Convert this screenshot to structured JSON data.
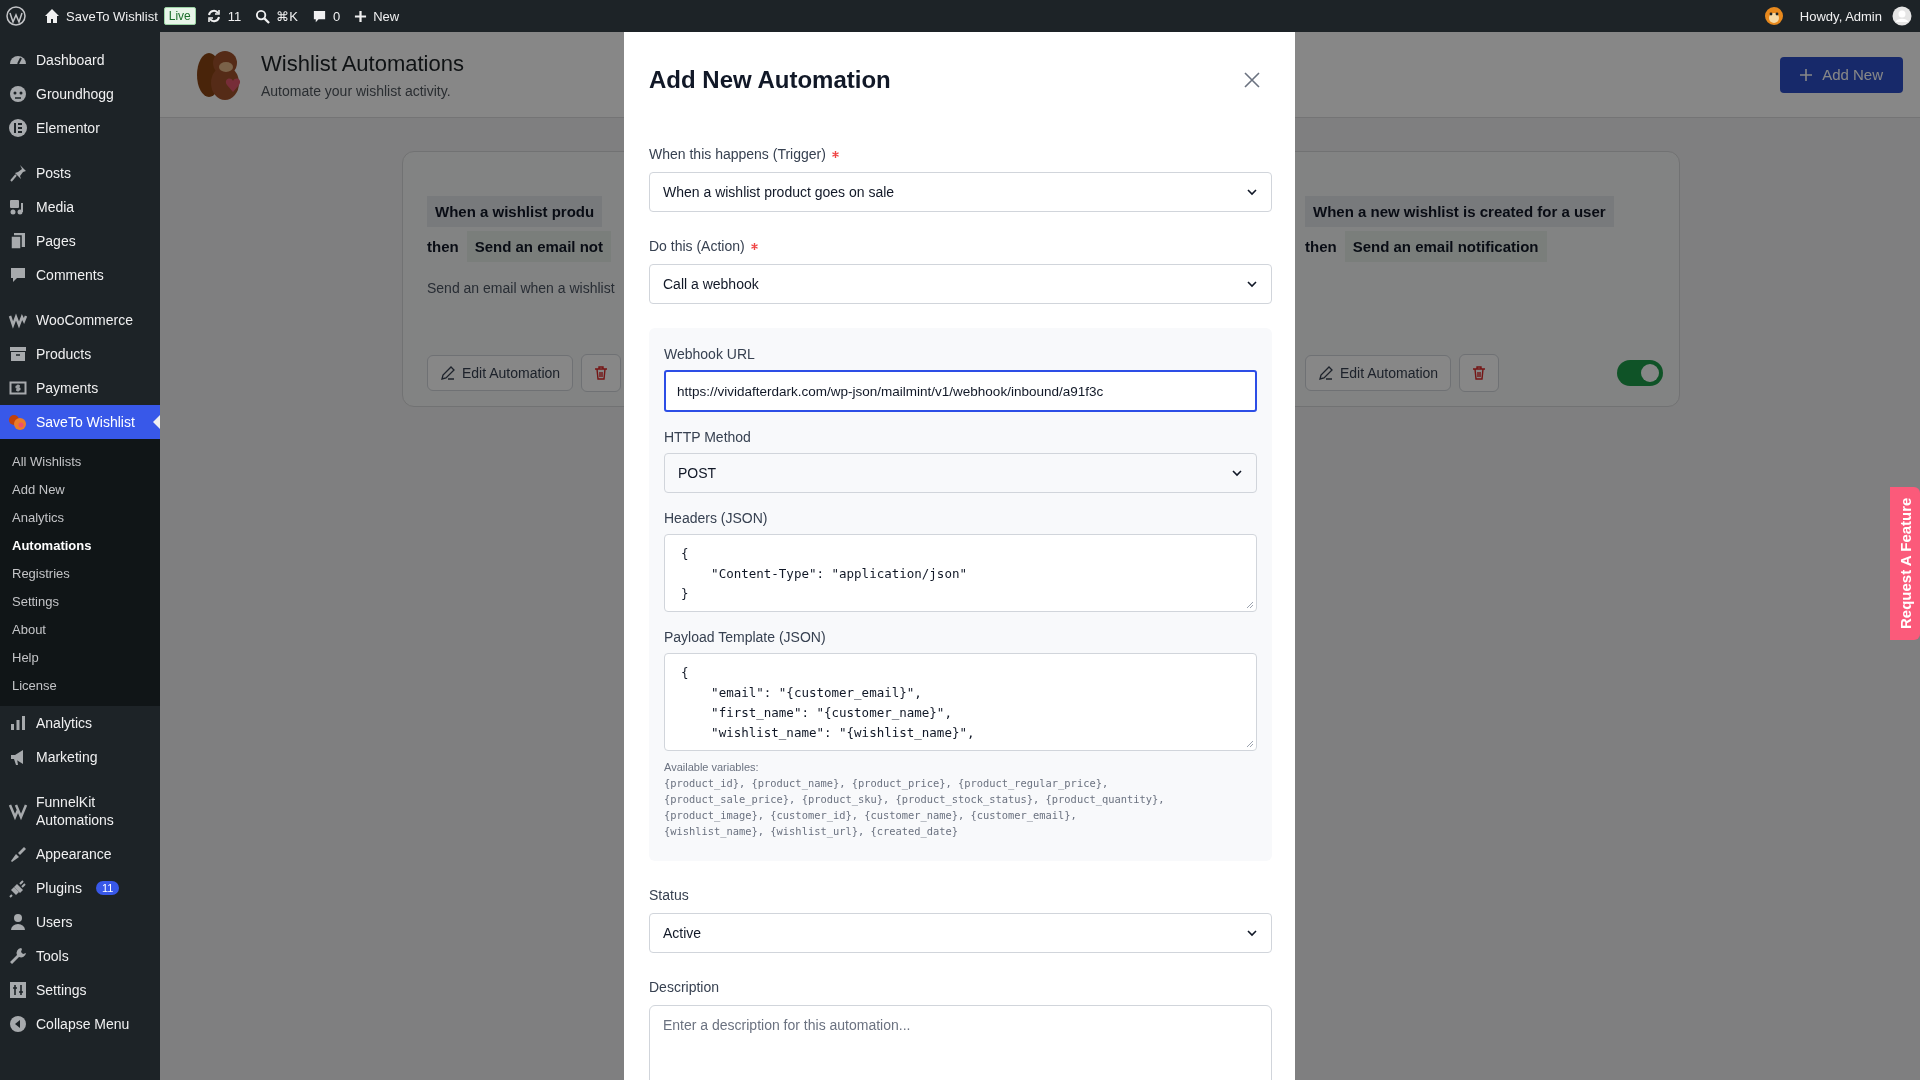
{
  "admin_bar": {
    "site_name": "SaveTo Wishlist",
    "status_badge": "Live",
    "updates": "11",
    "search_shortcut": "⌘K",
    "comments": "0",
    "new_label": "New",
    "greeting": "Howdy, Admin"
  },
  "sidebar": {
    "groups": [
      [
        {
          "label": "Dashboard",
          "selected": false
        },
        {
          "label": "Groundhogg",
          "selected": false
        },
        {
          "label": "Elementor",
          "selected": false
        }
      ],
      [
        {
          "label": "Posts",
          "selected": false
        },
        {
          "label": "Media",
          "selected": false
        },
        {
          "label": "Pages",
          "selected": false
        },
        {
          "label": "Comments",
          "selected": false
        }
      ],
      [
        {
          "label": "WooCommerce",
          "selected": false
        },
        {
          "label": "Products",
          "selected": false
        },
        {
          "label": "Payments",
          "selected": false
        },
        {
          "label": "SaveTo Wishlist",
          "selected": true,
          "children": [
            {
              "label": "All Wishlists",
              "selected": false
            },
            {
              "label": "Add New",
              "selected": false
            },
            {
              "label": "Analytics",
              "selected": false
            },
            {
              "label": "Automations",
              "selected": true
            },
            {
              "label": "Registries",
              "selected": false
            },
            {
              "label": "Settings",
              "selected": false
            },
            {
              "label": "About",
              "selected": false
            },
            {
              "label": "Help",
              "selected": false
            },
            {
              "label": "License",
              "selected": false
            }
          ]
        },
        {
          "label": "Analytics",
          "selected": false
        },
        {
          "label": "Marketing",
          "selected": false
        }
      ],
      [
        {
          "label": "FunnelKit Automations",
          "selected": false
        },
        {
          "label": "Appearance",
          "selected": false
        },
        {
          "label": "Plugins",
          "selected": false,
          "badge": "11"
        },
        {
          "label": "Users",
          "selected": false
        },
        {
          "label": "Tools",
          "selected": false
        },
        {
          "label": "Settings",
          "selected": false
        },
        {
          "label": "Collapse Menu",
          "selected": false
        }
      ]
    ]
  },
  "page": {
    "title": "Wishlist Automations",
    "subtitle": "Automate your wishlist activity.",
    "add_button": "Add New"
  },
  "automations": [
    {
      "trigger": "When a wishlist produ",
      "connector": "then",
      "action": "Send an email not",
      "description": "Send an email when a wishlist",
      "edit_button": "Edit Automation"
    },
    {
      "trigger": "When a new wishlist is created for a user",
      "connector": "then",
      "action": "Send an email notification",
      "edit_button": "Edit Automation",
      "active": true
    }
  ],
  "feedback_tab": "Request A Feature",
  "modal": {
    "title": "Add New Automation",
    "fields": [
      {
        "kind": "select",
        "label": "When this happens (Trigger)",
        "required": true,
        "value": "When a wishlist product goes on sale"
      },
      {
        "kind": "select",
        "label": "Do this (Action)",
        "required": true,
        "value": "Call a webhook"
      },
      {
        "kind": "panel",
        "fields": [
          {
            "kind": "input",
            "label": "Webhook URL",
            "value": "https://vividafterdark.com/wp-json/mailmint/v1/webhook/inbound/a91f3c",
            "focused": true
          },
          {
            "kind": "select",
            "label": "HTTP Method",
            "value": "POST"
          },
          {
            "kind": "code",
            "label": "Headers (JSON)",
            "lines": [
              "{",
              "    \"Content-Type\": \"application/json\"",
              "}"
            ]
          },
          {
            "kind": "code",
            "label": "Payload Template (JSON)",
            "lines": [
              "{",
              "    \"email\": \"{customer_email}\",",
              "    \"first_name\": \"{customer_name}\",",
              "    \"wishlist_name\": \"{wishlist_name}\","
            ],
            "help": {
              "title": "Available variables:",
              "lines": [
                "{product_id}, {product_name}, {product_price}, {product_regular_price},",
                "{product_sale_price}, {product_sku}, {product_stock_status}, {product_quantity},",
                "{product_image}, {customer_id}, {customer_name}, {customer_email},",
                "{wishlist_name}, {wishlist_url}, {created_date}"
              ]
            }
          }
        ]
      },
      {
        "kind": "select",
        "label": "Status",
        "required": false,
        "value": "Active"
      },
      {
        "kind": "textarea",
        "label": "Description",
        "required": false,
        "placeholder": "Enter a description for this automation..."
      }
    ]
  }
}
